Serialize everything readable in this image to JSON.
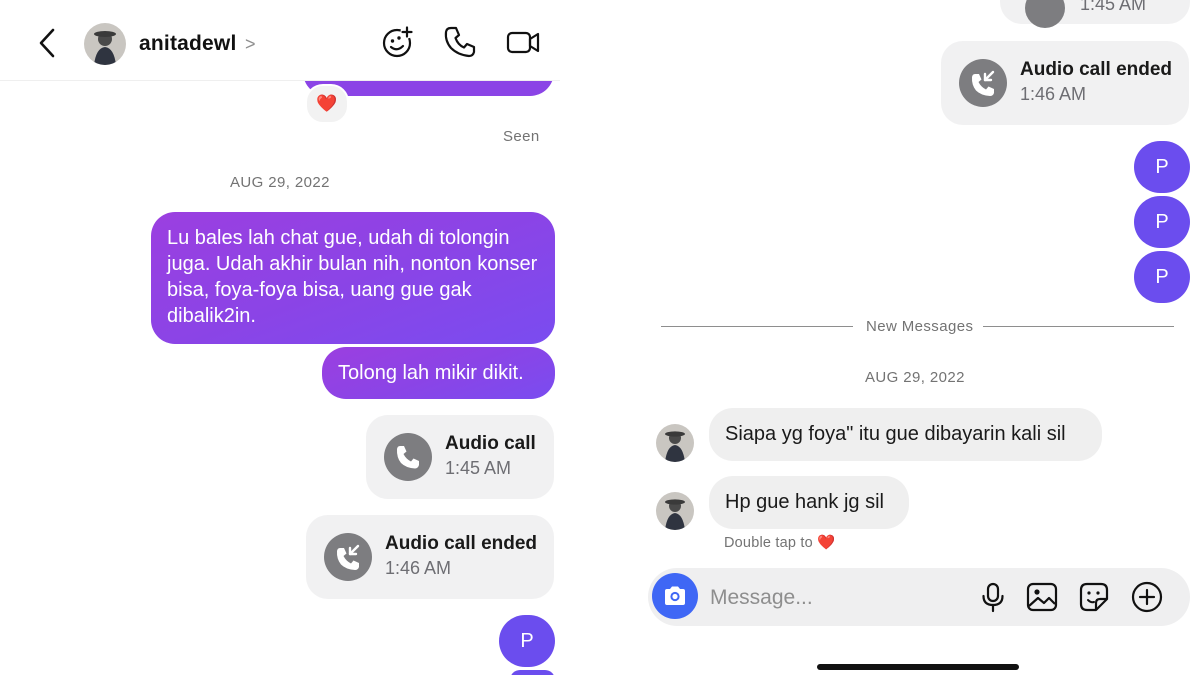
{
  "header": {
    "username": "anitadewl",
    "chevron": ">"
  },
  "left": {
    "reaction_emoji": "❤️",
    "seen_label": "Seen",
    "date_label": "AUG 29, 2022",
    "messages": [
      {
        "text": "Lu bales lah chat gue, udah di tolongin juga. Udah akhir bulan nih, nonton konser bisa, foya-foya bisa, uang gue gak dibalik2in."
      },
      {
        "text": "Tolong lah mikir dikit."
      }
    ],
    "audio_call": {
      "title": "Audio call",
      "time": "1:45 AM"
    },
    "audio_call_ended": {
      "title": "Audio call ended",
      "time": "1:46 AM"
    },
    "p_message": "P"
  },
  "right": {
    "top_call_partial_time": "1:45 AM",
    "audio_call_ended": {
      "title": "Audio call ended",
      "time": "1:46 AM"
    },
    "p_messages": [
      "P",
      "P",
      "P"
    ],
    "new_messages_label": "New Messages",
    "date_label": "AUG 29, 2022",
    "received": [
      {
        "text": "Siapa yg foya\" itu gue dibayarin kali sil"
      },
      {
        "text": "Hp gue hank jg sil"
      }
    ],
    "double_tap_label": "Double tap to",
    "double_tap_emoji": "❤️"
  },
  "composer": {
    "placeholder": "Message..."
  },
  "colors": {
    "sent_bubble": "#8b44e6",
    "p_bubble": "#6b4dee",
    "received_bubble": "#efefef",
    "camera_button": "#3f67f5",
    "heart": "#e0245e"
  },
  "icons": [
    "back-arrow-icon",
    "emoji-plus-icon",
    "phone-icon",
    "video-camera-icon",
    "phone-incoming-icon",
    "camera-icon",
    "microphone-icon",
    "image-icon",
    "sticker-icon",
    "plus-circle-icon"
  ]
}
